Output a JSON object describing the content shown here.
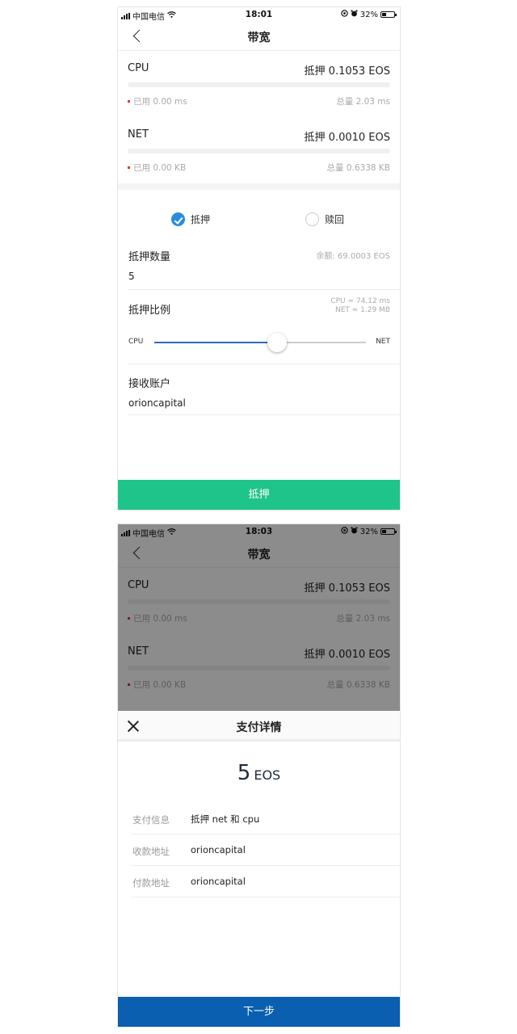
{
  "status_bar_1": {
    "carrier": "中国电信",
    "time": "18:01",
    "battery": "32%"
  },
  "status_bar_2": {
    "carrier": "中国电信",
    "time": "18:03",
    "battery": "32%"
  },
  "nav": {
    "title": "带宽"
  },
  "resources": {
    "cpu": {
      "name": "CPU",
      "staked": "抵押 0.1053 EOS",
      "used": "已用 0.00 ms",
      "total": "总量 2.03 ms"
    },
    "net": {
      "name": "NET",
      "staked": "抵押 0.0010 EOS",
      "used": "已用 0.00 KB",
      "total": "总量 0.6338 KB"
    }
  },
  "mode": {
    "stake_label": "抵押",
    "unstake_label": "赎回",
    "selected": "stake"
  },
  "stake_amount": {
    "label": "抵押数量",
    "balance": "余额: 69.0003 EOS",
    "value": "5"
  },
  "ratio": {
    "label": "抵押比例",
    "cpu_estimate": "CPU ≈ 74.12 ms",
    "net_estimate": "NET ≈ 1.29 MB",
    "left_label": "CPU",
    "right_label": "NET",
    "position": 0.58
  },
  "receiver": {
    "label": "接收账户",
    "value": "orioncapital"
  },
  "submit_label": "抵押",
  "payment": {
    "title": "支付详情",
    "amount": "5",
    "unit": "EOS",
    "rows": [
      {
        "key": "支付信息",
        "value": "抵押 net 和 cpu"
      },
      {
        "key": "收款地址",
        "value": "orioncapital"
      },
      {
        "key": "付款地址",
        "value": "orioncapital"
      }
    ],
    "next_label": "下一步"
  },
  "colors": {
    "accent_blue": "#2a8cdf",
    "submit_green": "#1fc48a",
    "next_blue": "#0a5fb0",
    "used_dot": "#ee3333"
  }
}
